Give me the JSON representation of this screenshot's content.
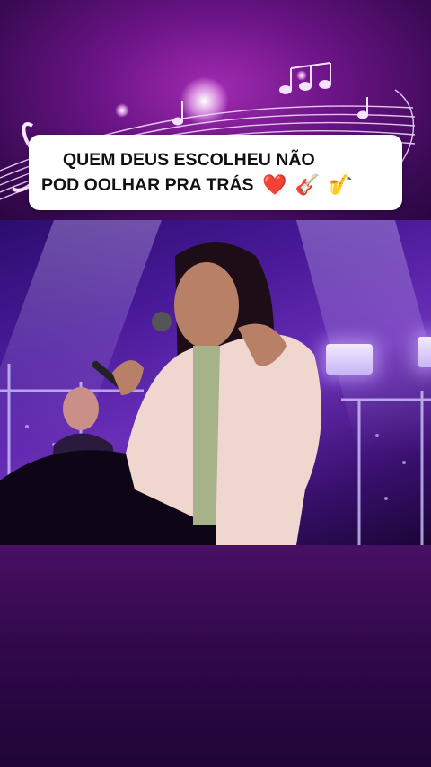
{
  "caption": {
    "line1": "QUEM DEUS ESCOLHEU NÃO",
    "line2": "POD OOLHAR PRA TRÁS",
    "emojis": [
      "❤️",
      "🎸",
      "🎷"
    ]
  },
  "colors": {
    "caption_bg": "#ffffff",
    "caption_text": "#111111",
    "background_purple": "#4a0f63"
  }
}
